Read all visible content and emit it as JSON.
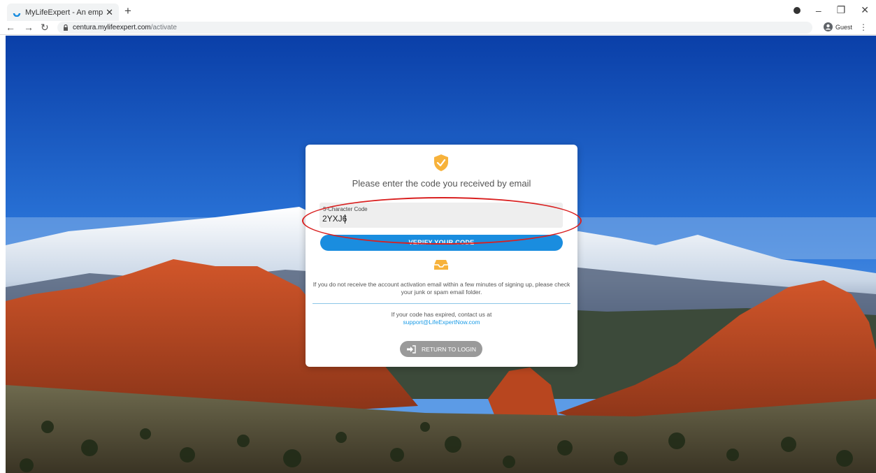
{
  "browser": {
    "tab_title": "MyLifeExpert - An employee wel",
    "url_host": "centura.mylifeexpert.com",
    "url_path": "/activate",
    "profile_label": "Guest"
  },
  "modal": {
    "heading": "Please enter the code you received by email",
    "code_field": {
      "label": "5-Character Code",
      "value": "2YXJ6"
    },
    "verify_button": "VERIFY YOUR CODE",
    "info_text": "If you do not receive the account activation email within a few minutes of signing up, please check your junk or spam email folder.",
    "expired_text": "If your code has expired, contact us at",
    "support_email": "support@LifeExpertNow.com",
    "return_button": "RETURN TO LOGIN"
  },
  "colors": {
    "primary": "#1a8ddf",
    "accent": "#f7b23b",
    "annotation": "#d92020"
  },
  "icons": {
    "shield": "shield-check-icon",
    "inbox": "inbox-icon",
    "login": "sign-in-icon"
  }
}
